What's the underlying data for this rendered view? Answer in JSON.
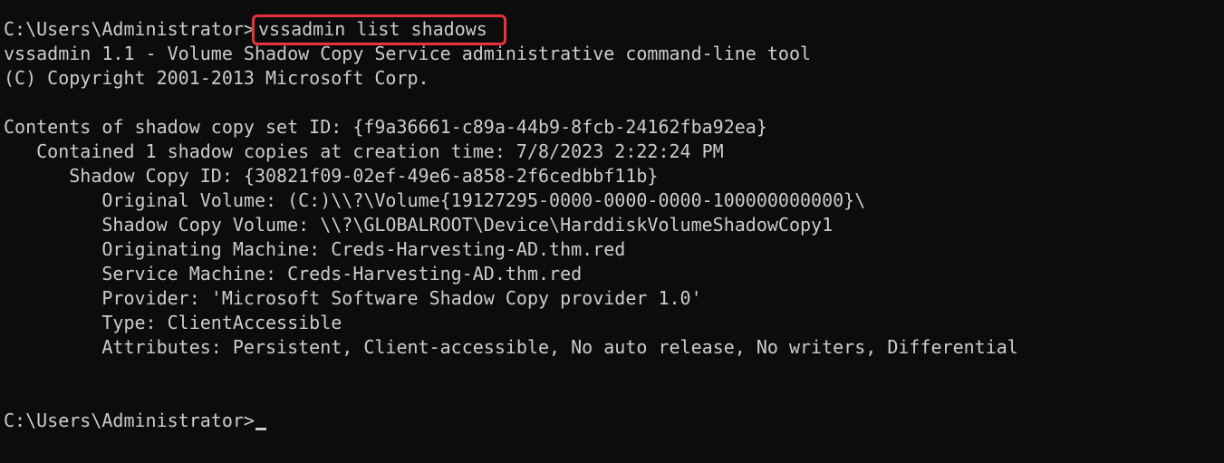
{
  "terminal": {
    "prompt": "C:\\Users\\Administrator>",
    "command": "vssadmin list shadows",
    "output": [
      "vssadmin 1.1 - Volume Shadow Copy Service administrative command-line tool",
      "(C) Copyright 2001-2013 Microsoft Corp.",
      "",
      "Contents of shadow copy set ID: {f9a36661-c89a-44b9-8fcb-24162fba92ea}",
      "   Contained 1 shadow copies at creation time: 7/8/2023 2:22:24 PM",
      "      Shadow Copy ID: {30821f09-02ef-49e6-a858-2f6cedbbf11b}",
      "         Original Volume: (C:)\\\\?\\Volume{19127295-0000-0000-0000-100000000000}\\",
      "         Shadow Copy Volume: \\\\?\\GLOBALROOT\\Device\\HarddiskVolumeShadowCopy1",
      "         Originating Machine: Creds-Harvesting-AD.thm.red",
      "         Service Machine: Creds-Harvesting-AD.thm.red",
      "         Provider: 'Microsoft Software Shadow Copy provider 1.0'",
      "         Type: ClientAccessible",
      "         Attributes: Persistent, Client-accessible, No auto release, No writers, Differential",
      "",
      ""
    ],
    "final_prompt": "C:\\Users\\Administrator>",
    "highlight_color": "#e8323c",
    "background_color": "#0c0c0c",
    "text_color": "#cccccc"
  }
}
